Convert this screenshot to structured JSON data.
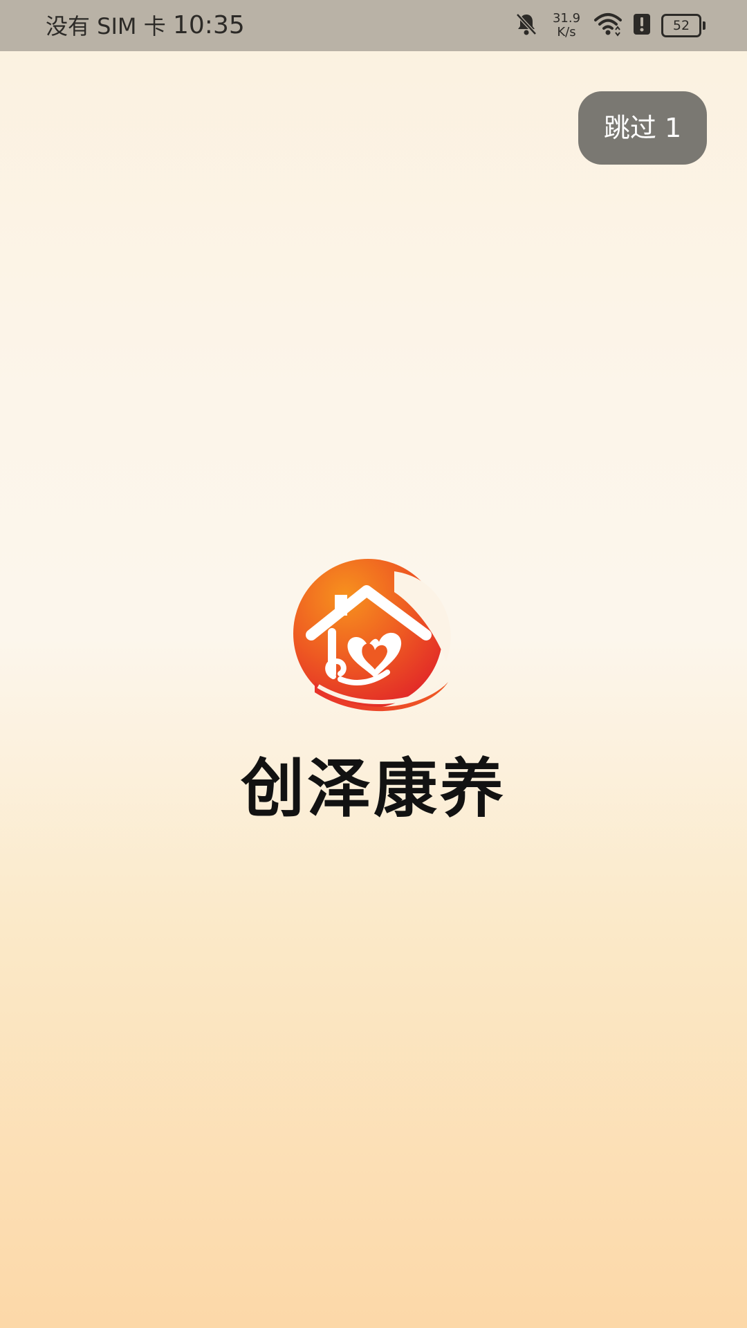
{
  "status_bar": {
    "carrier": "没有 SIM 卡",
    "time": "10:35",
    "net_speed_value": "31.9",
    "net_speed_unit": "K/s",
    "battery_level": "52",
    "icons": [
      "bell-muted-icon",
      "wifi-icon",
      "alert-icon",
      "battery-icon"
    ]
  },
  "splash": {
    "skip_label": "跳过 1",
    "brand_name": "创泽康养",
    "logo_icon": "house-heart-logo-icon"
  },
  "colors": {
    "logo_orange": "#f07a1c",
    "logo_red": "#e52b2a",
    "skip_bg": "#7a7872",
    "status_bar_bg": "#b9b2a6"
  }
}
